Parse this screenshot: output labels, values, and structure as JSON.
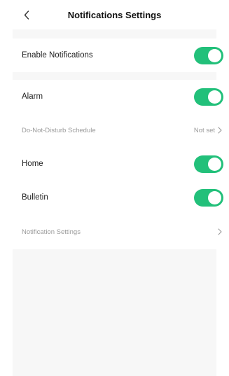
{
  "header": {
    "title": "Notifications Settings",
    "back_icon": "back-chevron-icon"
  },
  "rows": {
    "enable_notifications": {
      "label": "Enable Notifications",
      "toggle": "on"
    },
    "alarm": {
      "label": "Alarm",
      "toggle": "on"
    },
    "dnd_schedule": {
      "label": "Do-Not-Disturb Schedule",
      "value": "Not set"
    },
    "home": {
      "label": "Home",
      "toggle": "on"
    },
    "bulletin": {
      "label": "Bulletin",
      "toggle": "on"
    },
    "notification_settings": {
      "label": "Notification Settings"
    }
  },
  "colors": {
    "toggle_on": "#22c07a",
    "background": "#f7f7f7",
    "muted_text": "#9a9a9a"
  }
}
